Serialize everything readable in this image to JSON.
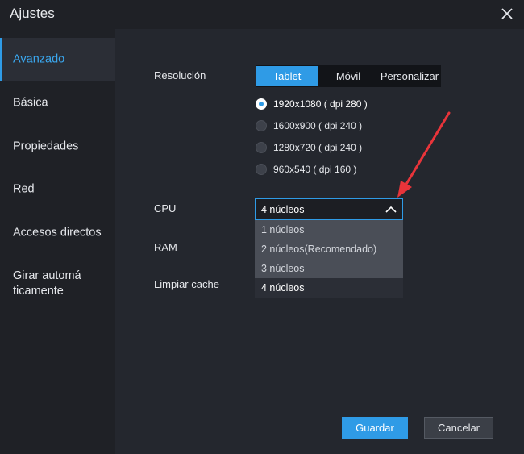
{
  "window": {
    "title": "Ajustes"
  },
  "sidebar": {
    "items": [
      {
        "label": "Avanzado",
        "active": true
      },
      {
        "label": "Básica"
      },
      {
        "label": "Propiedades"
      },
      {
        "label": "Red"
      },
      {
        "label": "Accesos directos"
      },
      {
        "label": "Girar automá ticamente"
      }
    ]
  },
  "settings": {
    "resolution": {
      "label": "Resolución",
      "tabs": [
        {
          "label": "Tablet",
          "active": true
        },
        {
          "label": "Móvil"
        },
        {
          "label": "Personalizar"
        }
      ],
      "options": [
        {
          "label": "1920x1080 ( dpi 280 )",
          "checked": true
        },
        {
          "label": "1600x900 ( dpi 240 )"
        },
        {
          "label": "1280x720 ( dpi 240 )"
        },
        {
          "label": "960x540 ( dpi 160 )"
        }
      ]
    },
    "cpu": {
      "label": "CPU",
      "selected": "4 núcleos",
      "options": [
        "1 núcleos",
        "2 núcleos(Recomendado)",
        "3 núcleos",
        "4 núcleos"
      ]
    },
    "ram": {
      "label": "RAM"
    },
    "cache": {
      "label": "Limpiar cache"
    }
  },
  "footer": {
    "save_label": "Guardar",
    "cancel_label": "Cancelar"
  },
  "colors": {
    "accent": "#2f9be6",
    "background": "#24272e",
    "sidebar": "#1f2126",
    "annotation_arrow": "#e8343a"
  },
  "icons": {
    "close": "close-icon",
    "dropdown": "chevron-up-icon"
  }
}
